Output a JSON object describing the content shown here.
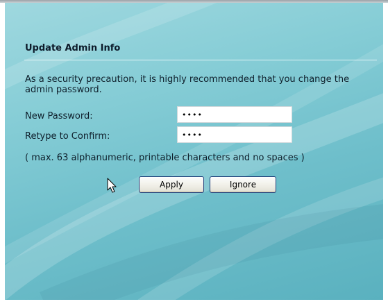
{
  "dialog": {
    "title": "Update Admin Info",
    "description": "As a security precaution, it is highly recommended that you change the admin password.",
    "new_password": {
      "label": "New Password:",
      "value": "••••"
    },
    "confirm_password": {
      "label": "Retype to Confirm:",
      "value": "••••"
    },
    "hint": "( max. 63 alphanumeric, printable characters and no spaces )",
    "buttons": {
      "apply": "Apply",
      "ignore": "Ignore"
    }
  },
  "colors": {
    "panel_light": "#9fd8df",
    "panel_dark": "#5ab1bf",
    "button_border": "#1f3f7a"
  },
  "icons": {
    "cursor": "mouse-pointer-icon"
  }
}
